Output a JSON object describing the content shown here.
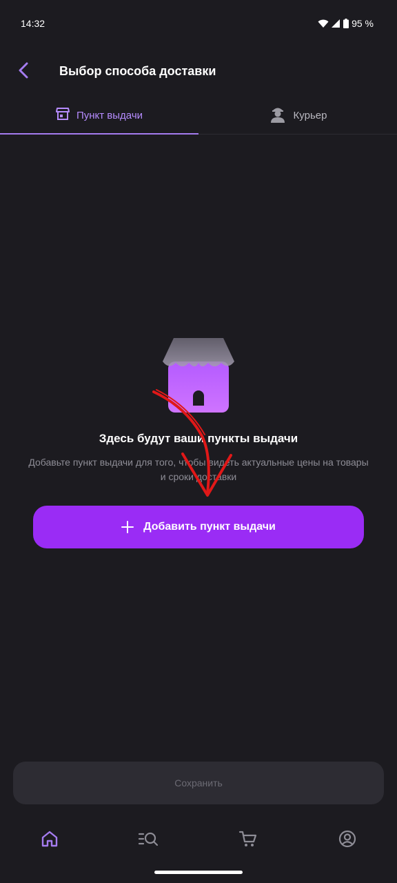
{
  "status_bar": {
    "time": "14:32",
    "battery": "95 %"
  },
  "header": {
    "title": "Выбор способа доставки",
    "back_icon": "chevron-left-icon"
  },
  "tabs": [
    {
      "label": "Пункт выдачи",
      "icon": "store-icon",
      "active": true
    },
    {
      "label": "Курьер",
      "icon": "courier-icon",
      "active": false
    }
  ],
  "empty_state": {
    "title": "Здесь будут ваши пункты выдачи",
    "description": "Добавьте пункт выдачи для того, чтобы видеть актуальные цены на товары и сроки доставки",
    "illustration": "shop-illustration"
  },
  "add_button": {
    "label": "Добавить пункт выдачи",
    "icon": "plus-icon"
  },
  "save_button": {
    "label": "Сохранить",
    "enabled": false
  },
  "bottom_nav": [
    {
      "name": "home",
      "icon": "home-icon",
      "active": true
    },
    {
      "name": "catalog",
      "icon": "catalog-search-icon",
      "active": false
    },
    {
      "name": "cart",
      "icon": "cart-icon",
      "active": false
    },
    {
      "name": "profile",
      "icon": "profile-icon",
      "active": false
    }
  ],
  "colors": {
    "background": "#1c1b20",
    "accent": "#9a2cf5",
    "active_tab": "#b68cff",
    "muted_text": "#8e8d96",
    "disabled_button": "#2d2c33",
    "annotation_arrow": "#e01818"
  }
}
